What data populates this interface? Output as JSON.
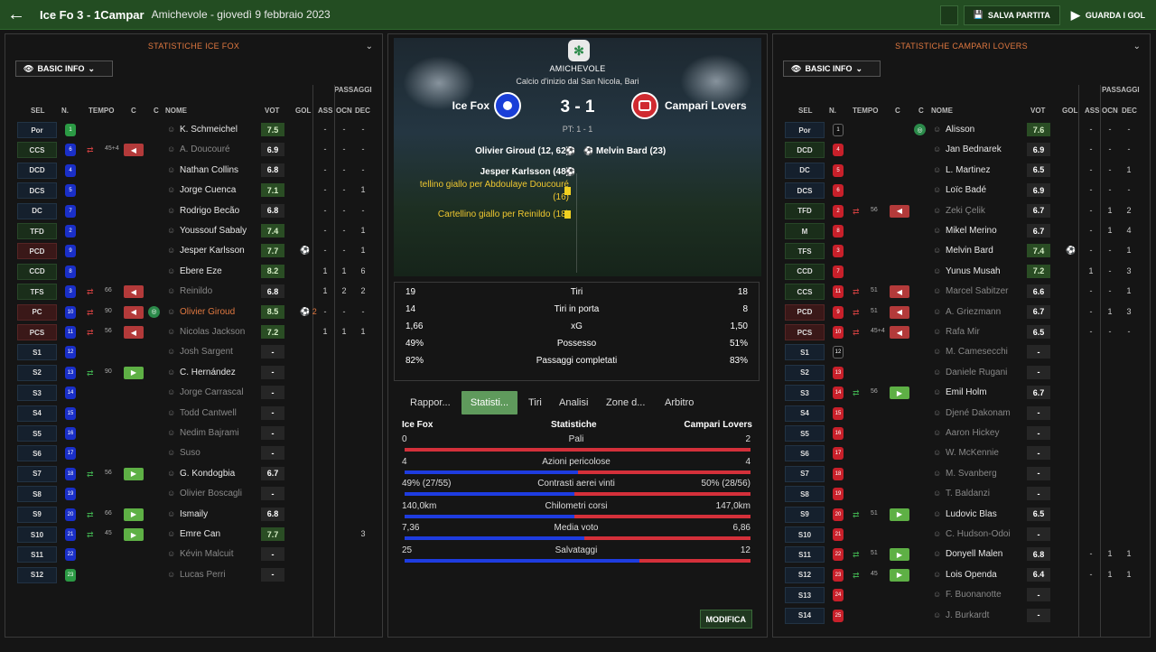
{
  "topbar": {
    "title": "Ice Fo 3 - 1Campar",
    "subtitle": "Amichevole - giovedì 9 febbraio 2023",
    "save_label": "SALVA PARTITA",
    "watch_label": "GUARDA I GOL"
  },
  "columns": {
    "sel": "SEL",
    "n": "N.",
    "tempo": "TEMPO",
    "c": "C",
    "nome": "NOME",
    "vot": "VOT",
    "gol": "GOL",
    "ass": "ASS",
    "ocn": "OCN",
    "dec": "DEC",
    "passaggi": "PASSAGGI"
  },
  "home_panel": {
    "title": "STATISTICHE ICE FOX",
    "basic_info": "BASIC INFO",
    "players": [
      {
        "pos": "Por",
        "num": "1",
        "name": "K. Schmeichel",
        "vote": "7.5",
        "ass": "-",
        "ocn": "-",
        "dec": "-",
        "gk": true,
        "green": true,
        "posClass": ""
      },
      {
        "pos": "CCS",
        "num": "6",
        "tempo": "45+4",
        "sub": "off",
        "card": "off",
        "name": "A. Doucouré",
        "vote": "6.9",
        "ass": "-",
        "ocn": "-",
        "dec": "-",
        "dim": true,
        "posClass": "m"
      },
      {
        "pos": "DCD",
        "num": "4",
        "name": "Nathan Collins",
        "vote": "6.8",
        "ass": "-",
        "ocn": "-",
        "dec": "-",
        "posClass": ""
      },
      {
        "pos": "DCS",
        "num": "5",
        "name": "Jorge Cuenca",
        "vote": "7.1",
        "ass": "-",
        "ocn": "-",
        "dec": "1",
        "green": true,
        "posClass": ""
      },
      {
        "pos": "DC",
        "num": "7",
        "name": "Rodrigo Becão",
        "vote": "6.8",
        "ass": "-",
        "ocn": "-",
        "dec": "-",
        "posClass": ""
      },
      {
        "pos": "TFD",
        "num": "2",
        "name": "Youssouf Sabaly",
        "vote": "7.4",
        "ass": "-",
        "ocn": "-",
        "dec": "1",
        "green": true,
        "posClass": "m"
      },
      {
        "pos": "PCD",
        "num": "9",
        "name": "Jesper Karlsson",
        "vote": "7.7",
        "gol": "⚽",
        "ass": "-",
        "ocn": "-",
        "dec": "1",
        "green": true,
        "posClass": "a"
      },
      {
        "pos": "CCD",
        "num": "8",
        "name": "Ebere Eze",
        "vote": "8.2",
        "ass": "1",
        "ocn": "1",
        "dec": "6",
        "green": true,
        "posClass": "m"
      },
      {
        "pos": "TFS",
        "num": "3",
        "tempo": "66",
        "sub": "off",
        "card": "off",
        "name": "Reinildo",
        "vote": "6.8",
        "ass": "1",
        "ocn": "2",
        "dec": "2",
        "dim": true,
        "posClass": "m"
      },
      {
        "pos": "PC",
        "num": "10",
        "tempo": "90",
        "sub": "off",
        "card": "off",
        "ball": true,
        "name": "Olivier Giroud",
        "vote": "8.5",
        "gol": "⚽ 2",
        "ass": "-",
        "ocn": "-",
        "dec": "-",
        "hl": true,
        "green": true,
        "posClass": "a"
      },
      {
        "pos": "PCS",
        "num": "11",
        "tempo": "56",
        "sub": "off",
        "card": "off",
        "name": "Nicolas Jackson",
        "vote": "7.2",
        "ass": "1",
        "ocn": "1",
        "dec": "1",
        "dim": true,
        "green": true,
        "posClass": "a"
      },
      {
        "pos": "S1",
        "num": "12",
        "name": "Josh Sargent",
        "vote": "-",
        "ass": "",
        "ocn": "",
        "dec": "",
        "dim": true,
        "posClass": ""
      },
      {
        "pos": "S2",
        "num": "13",
        "tempo": "90",
        "sub": "on",
        "card": "on",
        "name": "C. Hernández",
        "vote": "-",
        "ass": "",
        "ocn": "",
        "dec": "",
        "posClass": ""
      },
      {
        "pos": "S3",
        "num": "14",
        "name": "Jorge Carrascal",
        "vote": "-",
        "ass": "",
        "ocn": "",
        "dec": "",
        "dim": true,
        "posClass": ""
      },
      {
        "pos": "S4",
        "num": "15",
        "name": "Todd Cantwell",
        "vote": "-",
        "ass": "",
        "ocn": "",
        "dec": "",
        "dim": true,
        "posClass": ""
      },
      {
        "pos": "S5",
        "num": "16",
        "name": "Nedim Bajrami",
        "vote": "-",
        "ass": "",
        "ocn": "",
        "dec": "",
        "dim": true,
        "posClass": ""
      },
      {
        "pos": "S6",
        "num": "17",
        "name": "Suso",
        "vote": "-",
        "ass": "",
        "ocn": "",
        "dec": "",
        "dim": true,
        "posClass": ""
      },
      {
        "pos": "S7",
        "num": "18",
        "tempo": "56",
        "sub": "on",
        "card": "on",
        "name": "G. Kondogbia",
        "vote": "6.7",
        "ass": "",
        "ocn": "",
        "dec": "",
        "posClass": ""
      },
      {
        "pos": "S8",
        "num": "19",
        "name": "Olivier Boscagli",
        "vote": "-",
        "ass": "",
        "ocn": "",
        "dec": "",
        "dim": true,
        "posClass": ""
      },
      {
        "pos": "S9",
        "num": "20",
        "tempo": "66",
        "sub": "on",
        "card": "on",
        "name": "Ismaily",
        "vote": "6.8",
        "ass": "",
        "ocn": "",
        "dec": "",
        "posClass": ""
      },
      {
        "pos": "S10",
        "num": "21",
        "tempo": "45",
        "sub": "on",
        "card": "on",
        "name": "Emre Can",
        "vote": "7.7",
        "ass": "",
        "ocn": "",
        "dec": "3",
        "green": true,
        "posClass": ""
      },
      {
        "pos": "S11",
        "num": "22",
        "name": "Kévin Malcuit",
        "vote": "-",
        "ass": "",
        "ocn": "",
        "dec": "",
        "dim": true,
        "posClass": ""
      },
      {
        "pos": "S12",
        "num": "23",
        "name": "Lucas Perri",
        "vote": "-",
        "ass": "",
        "ocn": "",
        "dec": "",
        "dim": true,
        "gk": true,
        "posClass": ""
      }
    ]
  },
  "away_panel": {
    "title": "STATISTICHE CAMPARI LOVERS",
    "basic_info": "BASIC INFO",
    "players": [
      {
        "pos": "Por",
        "num": "1",
        "ball": true,
        "name": "Alisson",
        "vote": "7.6",
        "ass": "-",
        "ocn": "-",
        "dec": "-",
        "gkb": true,
        "green": true,
        "posClass": ""
      },
      {
        "pos": "DCD",
        "num": "4",
        "name": "Jan Bednarek",
        "vote": "6.9",
        "ass": "-",
        "ocn": "-",
        "dec": "-",
        "posClass": "m"
      },
      {
        "pos": "DC",
        "num": "5",
        "name": "L. Martinez",
        "vote": "6.5",
        "ass": "-",
        "ocn": "-",
        "dec": "1",
        "posClass": ""
      },
      {
        "pos": "DCS",
        "num": "6",
        "name": "Loïc Badé",
        "vote": "6.9",
        "ass": "-",
        "ocn": "-",
        "dec": "-",
        "posClass": ""
      },
      {
        "pos": "TFD",
        "num": "2",
        "tempo": "56",
        "sub": "off",
        "card": "off",
        "name": "Zeki Çelik",
        "vote": "6.7",
        "ass": "-",
        "ocn": "1",
        "dec": "2",
        "dim": true,
        "posClass": "m"
      },
      {
        "pos": "M",
        "num": "8",
        "name": "Mikel Merino",
        "vote": "6.7",
        "ass": "-",
        "ocn": "1",
        "dec": "4",
        "posClass": "m"
      },
      {
        "pos": "TFS",
        "num": "3",
        "name": "Melvin Bard",
        "vote": "7.4",
        "gol": "⚽",
        "ass": "-",
        "ocn": "-",
        "dec": "1",
        "green": true,
        "posClass": "m"
      },
      {
        "pos": "CCD",
        "num": "7",
        "name": "Yunus Musah",
        "vote": "7.2",
        "ass": "1",
        "ocn": "-",
        "dec": "3",
        "green": true,
        "posClass": "m"
      },
      {
        "pos": "CCS",
        "num": "11",
        "tempo": "51",
        "sub": "off",
        "card": "off",
        "name": "Marcel Sabitzer",
        "vote": "6.6",
        "ass": "-",
        "ocn": "-",
        "dec": "1",
        "dim": true,
        "posClass": "m"
      },
      {
        "pos": "PCD",
        "num": "9",
        "tempo": "51",
        "sub": "off",
        "card": "off",
        "name": "A. Griezmann",
        "vote": "6.7",
        "ass": "-",
        "ocn": "1",
        "dec": "3",
        "dim": true,
        "posClass": "a"
      },
      {
        "pos": "PCS",
        "num": "10",
        "tempo": "45+4",
        "sub": "off",
        "card": "off",
        "name": "Rafa Mir",
        "vote": "6.5",
        "ass": "-",
        "ocn": "-",
        "dec": "-",
        "dim": true,
        "posClass": "a"
      },
      {
        "pos": "S1",
        "num": "12",
        "name": "M. Camesecchi",
        "vote": "-",
        "ass": "",
        "ocn": "",
        "dec": "",
        "dim": true,
        "gkb": true,
        "posClass": ""
      },
      {
        "pos": "S2",
        "num": "13",
        "name": "Daniele Rugani",
        "vote": "-",
        "ass": "",
        "ocn": "",
        "dec": "",
        "dim": true,
        "posClass": ""
      },
      {
        "pos": "S3",
        "num": "14",
        "tempo": "56",
        "sub": "on",
        "card": "on",
        "name": "Emil Holm",
        "vote": "6.7",
        "ass": "",
        "ocn": "",
        "dec": "",
        "posClass": ""
      },
      {
        "pos": "S4",
        "num": "15",
        "name": "Djené Dakonam",
        "vote": "-",
        "ass": "",
        "ocn": "",
        "dec": "",
        "dim": true,
        "posClass": ""
      },
      {
        "pos": "S5",
        "num": "16",
        "name": "Aaron Hickey",
        "vote": "-",
        "ass": "",
        "ocn": "",
        "dec": "",
        "dim": true,
        "posClass": ""
      },
      {
        "pos": "S6",
        "num": "17",
        "name": "W. McKennie",
        "vote": "-",
        "ass": "",
        "ocn": "",
        "dec": "",
        "dim": true,
        "posClass": ""
      },
      {
        "pos": "S7",
        "num": "18",
        "name": "M. Svanberg",
        "vote": "-",
        "ass": "",
        "ocn": "",
        "dec": "",
        "dim": true,
        "posClass": ""
      },
      {
        "pos": "S8",
        "num": "19",
        "name": "T. Baldanzi",
        "vote": "-",
        "ass": "",
        "ocn": "",
        "dec": "",
        "dim": true,
        "posClass": ""
      },
      {
        "pos": "S9",
        "num": "20",
        "tempo": "51",
        "sub": "on",
        "card": "on",
        "name": "Ludovic Blas",
        "vote": "6.5",
        "ass": "",
        "ocn": "",
        "dec": "",
        "posClass": ""
      },
      {
        "pos": "S10",
        "num": "21",
        "name": "C. Hudson-Odoi",
        "vote": "-",
        "ass": "",
        "ocn": "",
        "dec": "",
        "dim": true,
        "posClass": ""
      },
      {
        "pos": "S11",
        "num": "22",
        "tempo": "51",
        "sub": "on",
        "card": "on",
        "name": "Donyell Malen",
        "vote": "6.8",
        "ass": "-",
        "ocn": "1",
        "dec": "1",
        "posClass": ""
      },
      {
        "pos": "S12",
        "num": "23",
        "tempo": "45",
        "sub": "on",
        "card": "on",
        "name": "Lois Openda",
        "vote": "6.4",
        "ass": "-",
        "ocn": "1",
        "dec": "1",
        "posClass": ""
      },
      {
        "pos": "S13",
        "num": "24",
        "name": "F. Buonanotte",
        "vote": "-",
        "ass": "",
        "ocn": "",
        "dec": "",
        "dim": true,
        "posClass": ""
      },
      {
        "pos": "S14",
        "num": "25",
        "name": "J. Burkardt",
        "vote": "-",
        "ass": "",
        "ocn": "",
        "dec": "",
        "dim": true,
        "posClass": ""
      }
    ]
  },
  "match": {
    "competition": "AMICHEVOLE",
    "venue": "Calcio d'inizio dal San Nicola, Bari",
    "home": "Ice Fox",
    "away": "Campari Lovers",
    "score": "3 - 1",
    "halftime": "PT: 1 - 1",
    "events_home": [
      {
        "text": "Olivier Giroud (12, 62)",
        "type": "goal"
      },
      {
        "text": "Jesper Karlsson (48)",
        "type": "goal"
      },
      {
        "text": "tellino giallo per Abdoulaye Doucouré",
        "text2": "(16)",
        "type": "card"
      },
      {
        "text": "Cartellino giallo per Reinildo (18)",
        "type": "card"
      }
    ],
    "events_away": [
      {
        "text": "Melvin Bard (23)",
        "type": "goal"
      }
    ]
  },
  "summary": [
    {
      "h": "19",
      "label": "Tiri",
      "a": "18"
    },
    {
      "h": "14",
      "label": "Tiri in porta",
      "a": "8"
    },
    {
      "h": "1,66",
      "label": "xG",
      "a": "1,50"
    },
    {
      "h": "49%",
      "label": "Possesso",
      "a": "51%"
    },
    {
      "h": "82%",
      "label": "Passaggi completati",
      "a": "83%"
    }
  ],
  "tabs": [
    "Rappor...",
    "Statisti...",
    "Tiri",
    "Analisi",
    "Zone d...",
    "Arbitro"
  ],
  "stats_header": {
    "home": "Ice Fox",
    "mid": "Statistiche",
    "away": "Campari Lovers"
  },
  "stats": [
    {
      "h": "0",
      "label": "Pali",
      "a": "2",
      "frac": 0
    },
    {
      "h": "4",
      "label": "Azioni pericolose",
      "a": "4",
      "frac": 0.5
    },
    {
      "h": "49% (27/55)",
      "label": "Contrasti aerei vinti",
      "a": "50% (28/56)",
      "frac": 0.49
    },
    {
      "h": "140,0km",
      "label": "Chilometri corsi",
      "a": "147,0km",
      "frac": 0.49
    },
    {
      "h": "7,36",
      "label": "Media voto",
      "a": "6,86",
      "frac": 0.52
    },
    {
      "h": "25",
      "label": "Salvataggi",
      "a": "12",
      "frac": 0.68
    }
  ],
  "modifica": "MODIFICA",
  "colors": {
    "topbar": "#234d22",
    "accent_orange": "#e07840",
    "home_blue": "#1e3ce0",
    "away_red": "#d4303a",
    "tab_active": "#5f9a5c"
  }
}
